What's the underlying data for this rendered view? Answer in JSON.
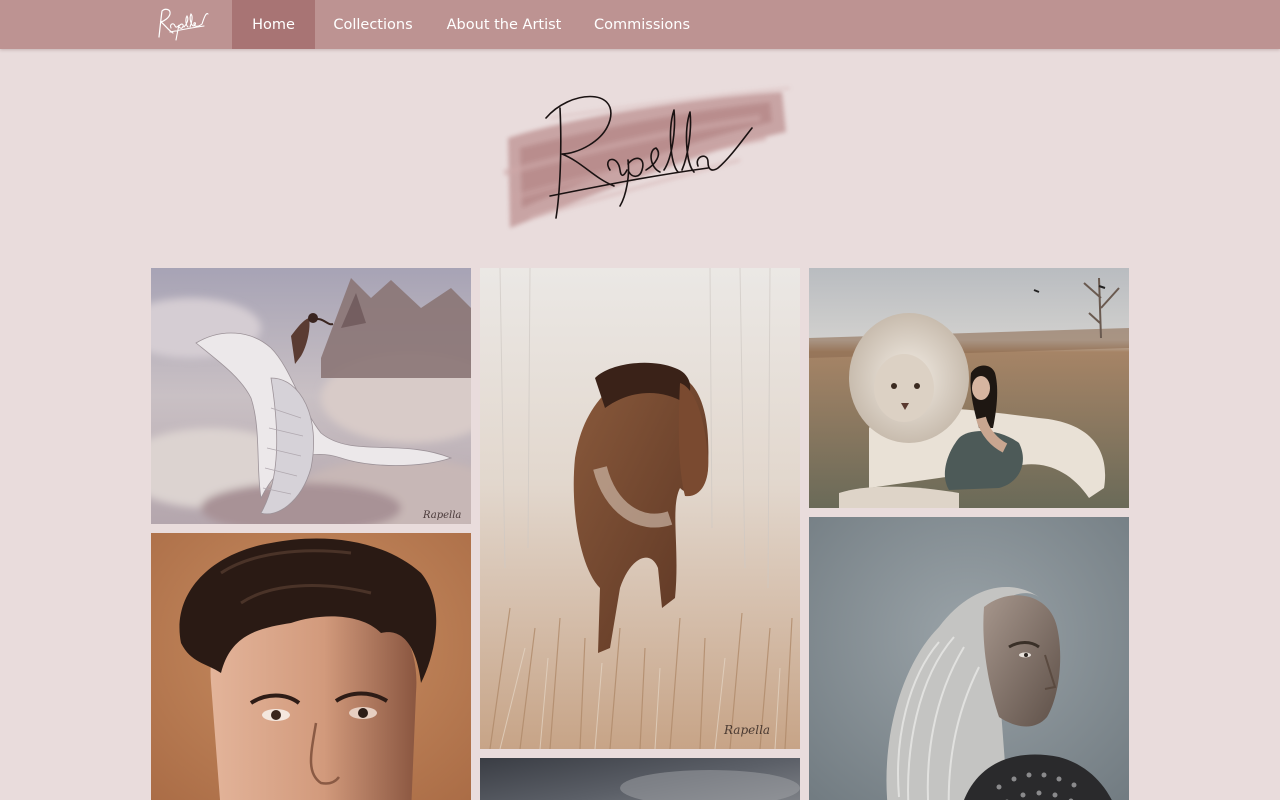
{
  "brand": {
    "logo_text": "Rapella",
    "accent_color": "#bd9392",
    "active_nav_color": "#a87474",
    "background_color": "#e9dcdc"
  },
  "nav": {
    "items": [
      {
        "label": "Home",
        "active": true
      },
      {
        "label": "Collections",
        "active": false
      },
      {
        "label": "About the Artist",
        "active": false
      },
      {
        "label": "Commissions",
        "active": false
      }
    ]
  },
  "hero": {
    "logo_text": "Rapella"
  },
  "gallery": {
    "signature": "Rapella",
    "artworks": [
      {
        "subject": "dragon-rider"
      },
      {
        "subject": "young-man-portrait"
      },
      {
        "subject": "horse-in-meadow"
      },
      {
        "subject": "stormy-sky"
      },
      {
        "subject": "lion-and-woman"
      },
      {
        "subject": "white-haired-warrior"
      }
    ]
  }
}
